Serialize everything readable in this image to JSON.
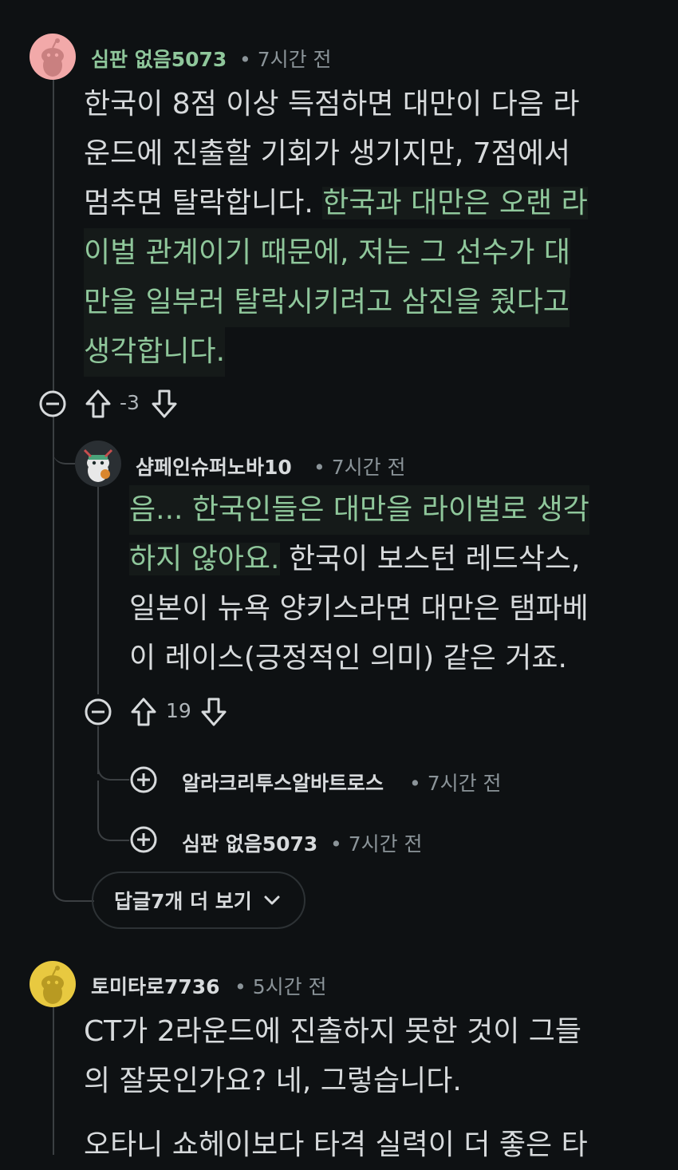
{
  "comments": [
    {
      "username": "심판 없음5073",
      "time": "• 7시간 전",
      "lines": [
        "한국이 8점 이상 득점하면 대만이 다음 라",
        "운드에 진출할 기회가 생기지만, 7점에서",
        "멈추면 탈락합니다. ",
        "한국과 대만은 오랜 라",
        "이벌 관계이기 때문에, 저는 그 선수가 대",
        "만을 일부러 탈락시키려고 삼진을 줬다고",
        "생각합니다."
      ],
      "votes": "-3"
    },
    {
      "username": "샴페인슈퍼노바10",
      "time": "• 7시간 전",
      "lines": [
        "음... 한국인들은 대만을 라이벌로 생각",
        "하지 않아요.",
        " 한국이 보스턴 레드삭스,",
        "일본이 뉴욕 양키스라면 대만은 탬파베",
        "이 레이스(긍정적인 의미) 같은 거죠."
      ],
      "votes": "19"
    },
    {
      "username": "알라크리투스알바트로스",
      "time": "• 7시간 전"
    },
    {
      "username": "심판 없음5073",
      "time": "• 7시간 전"
    },
    {
      "username": "토미타로7736",
      "time": "• 5시간 전",
      "lines": [
        "CT가 2라운드에 진출하지 못한 것이 그들",
        "의 잘못인가요? 네, 그렇습니다.",
        "오타니 쇼헤이보다 타격 실력이 더 좋은 타"
      ]
    }
  ],
  "more_replies": {
    "label": "답글7개 더 보기",
    "icon": "chevron-down-icon"
  },
  "colors": {
    "background": "#0e1113",
    "text": "#d7dadc",
    "highlight_text": "#8fc79b",
    "meta": "#8b9499",
    "thread_line": "#3b3f42"
  }
}
